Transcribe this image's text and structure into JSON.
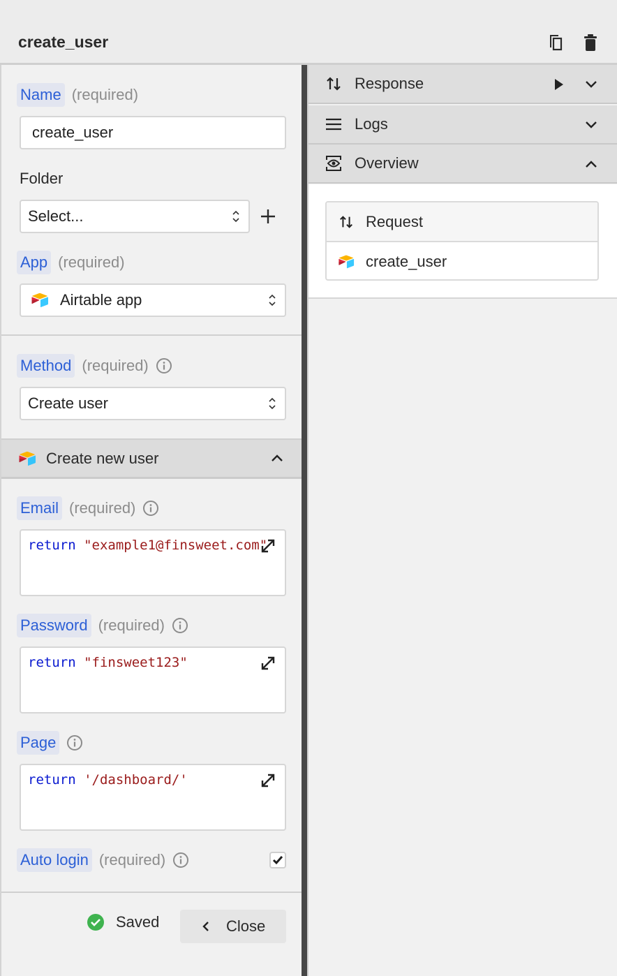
{
  "header": {
    "title": "create_user",
    "actions": [
      {
        "name": "duplicate",
        "icon": "copy-icon"
      },
      {
        "name": "delete",
        "icon": "trash-icon"
      }
    ]
  },
  "form": {
    "name": {
      "label": "Name",
      "required_text": "(required)",
      "value": "create_user"
    },
    "folder": {
      "label": "Folder",
      "selected": "Select...",
      "add_icon": "plus-icon"
    },
    "app": {
      "label": "App",
      "required_text": "(required)",
      "selected": "Airtable app",
      "icon": "airtable-icon"
    },
    "method": {
      "label": "Method",
      "required_text": "(required)",
      "selected": "Create user",
      "info_icon": "info-icon"
    },
    "section": {
      "title": "Create new user",
      "icon": "airtable-icon",
      "expanded": true
    },
    "email": {
      "label": "Email",
      "required_text": "(required)",
      "keyword": "return",
      "literal": "\"example1@finsweet.com\""
    },
    "password": {
      "label": "Password",
      "required_text": "(required)",
      "keyword": "return",
      "literal": "\"finsweet123\""
    },
    "page": {
      "label": "Page",
      "keyword": "return",
      "literal": "'/dashboard/'"
    },
    "auto_login": {
      "label": "Auto login",
      "required_text": "(required)",
      "checked": true
    }
  },
  "footer": {
    "status": "Saved",
    "status_color": "#3fb34f",
    "close_label": "Close"
  },
  "right_panel": {
    "accordions": [
      {
        "label": "Response",
        "icon": "arrows-up-down-icon",
        "expanded": false,
        "has_run": true
      },
      {
        "label": "Logs",
        "icon": "list-icon",
        "expanded": false
      },
      {
        "label": "Overview",
        "icon": "eye-icon",
        "expanded": true
      }
    ],
    "overview": {
      "header": "Request",
      "items": [
        {
          "label": "create_user",
          "icon": "airtable-icon"
        }
      ]
    }
  },
  "colors": {
    "label_accent": "#2c5fd6",
    "label_bg": "#e2e5f0",
    "code_keyword": "#0a1ad0",
    "code_string": "#9a1b1b",
    "divider": "#474747"
  }
}
